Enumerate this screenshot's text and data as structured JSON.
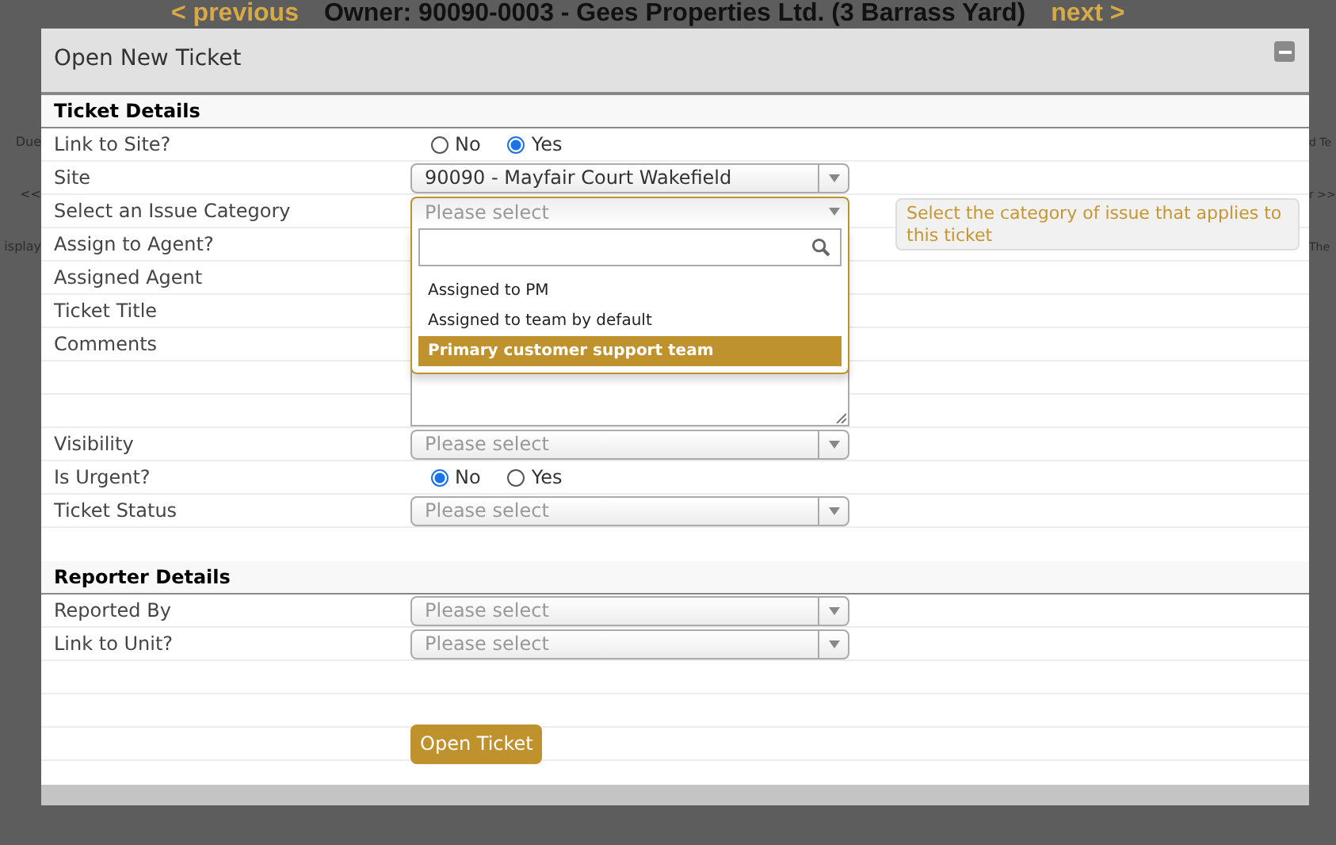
{
  "background_page": {
    "prev_link": "< previous",
    "heading": "Owner: 90090-0003 - Gees Properties Ltd. (3 Barrass Yard)",
    "next_link": "next >",
    "left_fragments": [
      "Due",
      "<<",
      "isplay"
    ],
    "right_fragments": [
      "d Te",
      "r >>",
      "The"
    ]
  },
  "dialog": {
    "title": "Open New Ticket",
    "sections": [
      {
        "title": "Ticket Details",
        "rows": [
          {
            "label": "Link to Site?",
            "kind": "radio",
            "options": [
              {
                "label": "No",
                "selected": false
              },
              {
                "label": "Yes",
                "selected": true
              }
            ]
          },
          {
            "label": "Site",
            "kind": "select",
            "value": "90090 - Mayfair Court Wakefield"
          },
          {
            "label": "Select an Issue Category",
            "kind": "select",
            "placeholder": "Please select",
            "expanded": true,
            "options": [
              {
                "label": "Assigned to PM",
                "selected": false
              },
              {
                "label": "Assigned to team by default",
                "selected": false
              },
              {
                "label": "Primary customer support team",
                "selected": true
              }
            ],
            "hint": "Select the category of issue that applies to this ticket"
          },
          {
            "label": "Assign to Agent?",
            "kind": "hidden"
          },
          {
            "label": "Assigned Agent",
            "kind": "hidden"
          },
          {
            "label": "Ticket Title",
            "kind": "hidden"
          },
          {
            "label": "Comments",
            "kind": "textarea"
          },
          {
            "label": "Visibility",
            "kind": "select",
            "placeholder": "Please select"
          },
          {
            "label": "Is Urgent?",
            "kind": "radio",
            "options": [
              {
                "label": "No",
                "selected": true
              },
              {
                "label": "Yes",
                "selected": false
              }
            ]
          },
          {
            "label": "Ticket Status",
            "kind": "select",
            "placeholder": "Please select"
          }
        ]
      },
      {
        "title": "Reporter Details",
        "rows": [
          {
            "label": "Reported By",
            "kind": "select",
            "placeholder": "Please select"
          },
          {
            "label": "Link to Unit?",
            "kind": "select",
            "placeholder": "Please select"
          }
        ]
      }
    ],
    "submit_button": "Open Ticket"
  }
}
